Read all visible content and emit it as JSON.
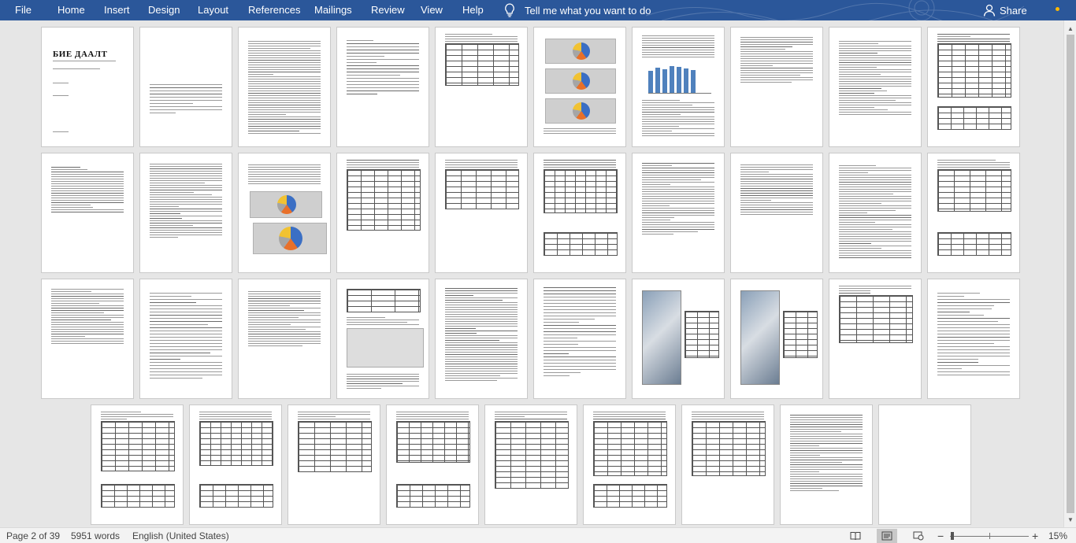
{
  "ribbon": {
    "file": "File",
    "tabs": [
      "Home",
      "Insert",
      "Design",
      "Layout",
      "References",
      "Mailings",
      "Review",
      "View",
      "Help"
    ],
    "tell_me": "Tell me what you want to do",
    "share": "Share",
    "colors": {
      "ribbon_bg": "#2b579a",
      "notification_dot": "#ffb900"
    }
  },
  "document": {
    "cover_title": "БИЕ ДААЛТ",
    "pages_shown": 39
  },
  "status": {
    "page_info": "Page 2 of 39",
    "word_count": "5951 words",
    "language": "English (United States)",
    "zoom": "15%",
    "zoom_value_percent": 15,
    "view_mode": "print-layout"
  },
  "icons": {
    "tell_me": "lightbulb-icon",
    "share": "person-icon",
    "read_mode": "book-icon",
    "print_layout": "page-icon",
    "web_layout": "web-icon",
    "zoom_out": "minus-icon",
    "zoom_in": "plus-icon",
    "scroll_up": "chevron-up-icon",
    "scroll_down": "chevron-down-icon"
  }
}
